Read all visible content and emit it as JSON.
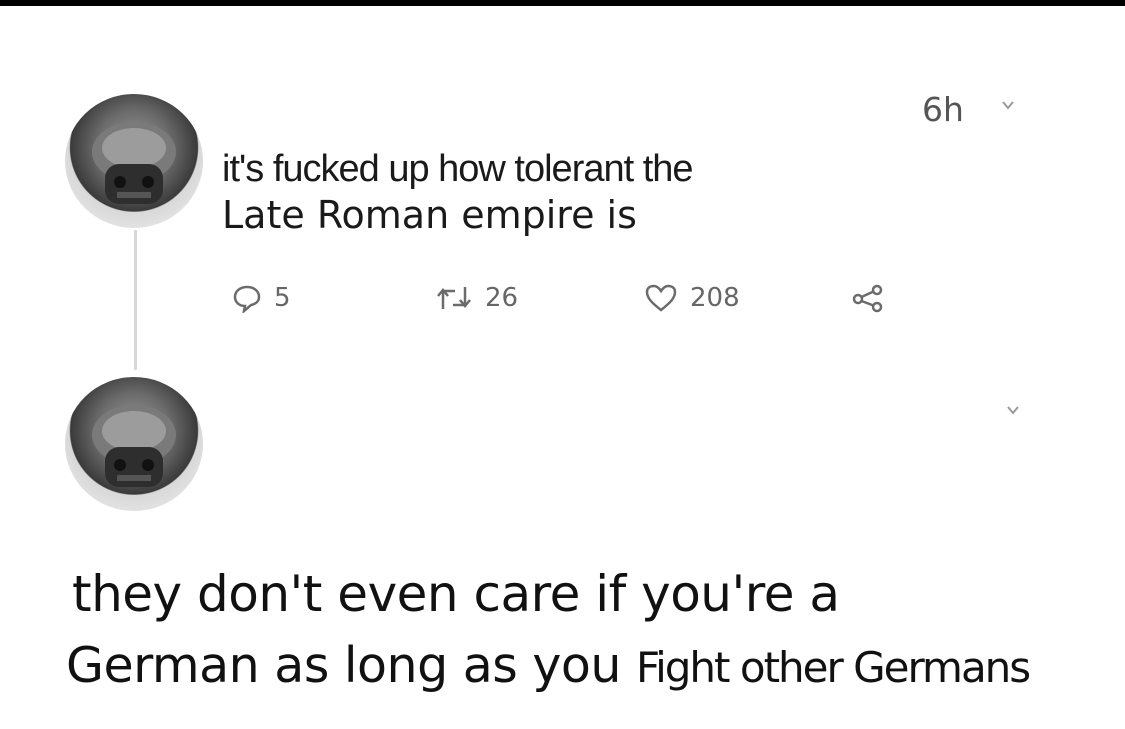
{
  "tweet": {
    "time": "6h",
    "text_line1": "it's fucked up how tolerant the",
    "text_line2": "Late Roman empire is",
    "reply_count": "5",
    "retweet_count": "26",
    "like_count": "208"
  },
  "caption": {
    "line1": "they don't even care if you're a",
    "line2_part1": "German",
    "line2_part2": "as long as you",
    "line2_part3": "Fight other Germans"
  },
  "colors": {
    "icon": "#6b6b6b",
    "text": "#111111",
    "background": "#ffffff",
    "thread_line": "#d9d9d9"
  }
}
